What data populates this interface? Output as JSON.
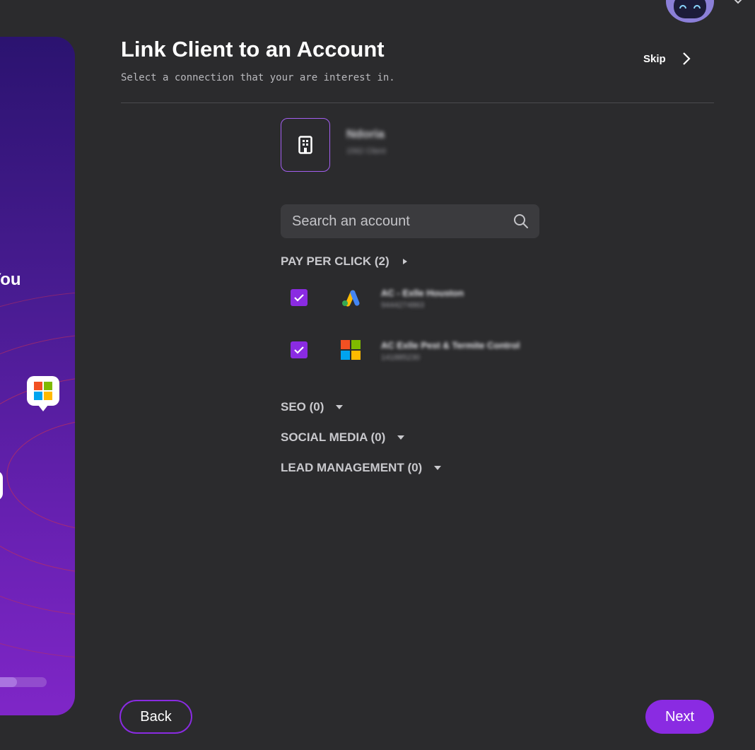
{
  "left_panel": {
    "promo_text": "You",
    "progress": 0.6
  },
  "header": {
    "title": "Link Client to an Account",
    "subtitle": "Select a connection that your are interest in.",
    "skip_label": "Skip"
  },
  "client": {
    "name": "Ndoria",
    "subtitle": "1562 Client"
  },
  "search": {
    "placeholder": "Search an account"
  },
  "sections": {
    "ppc": {
      "label": "PAY PER CLICK (2)",
      "expanded": true,
      "accounts": [
        {
          "name": "AC - Exlle Houston",
          "id": "9444274863",
          "platform": "google-ads",
          "checked": true
        },
        {
          "name": "AC Exlle Pest & Termite Control",
          "id": "141885230",
          "platform": "microsoft-ads",
          "checked": true
        }
      ]
    },
    "seo": {
      "label": "SEO (0)"
    },
    "social": {
      "label": "SOCIAL MEDIA (0)"
    },
    "lead": {
      "label": "LEAD MANAGEMENT (0)"
    }
  },
  "footer": {
    "back_label": "Back",
    "next_label": "Next"
  },
  "colors": {
    "accent": "#8a2be2",
    "background": "#2b2b2d",
    "panel_gradient_top": "#2b1370",
    "panel_gradient_bottom": "#7f26c7"
  }
}
